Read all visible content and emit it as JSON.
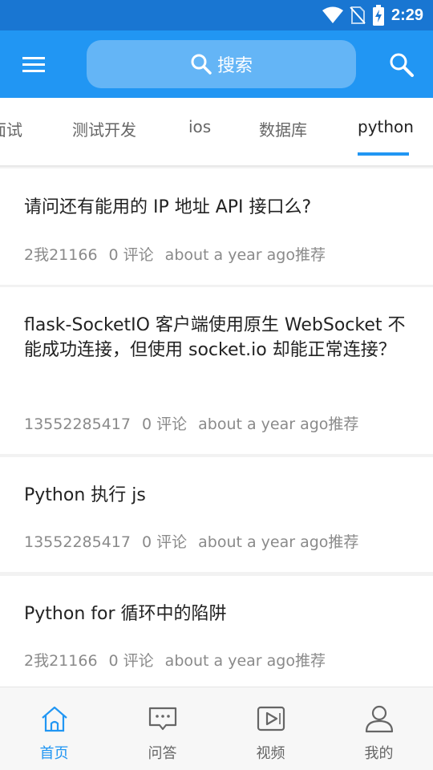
{
  "status_bar": {
    "time": "2:29"
  },
  "app_bar": {
    "search_label": "搜索"
  },
  "tabs": [
    {
      "label": "面试"
    },
    {
      "label": "测试开发"
    },
    {
      "label": "ios"
    },
    {
      "label": "数据库"
    },
    {
      "label": "python",
      "active": true
    }
  ],
  "posts": [
    {
      "title": "请问还有能用的 IP 地址 API 接口么?",
      "author": "2我21166",
      "comments": "0 评论",
      "time": "about a year ago推荐"
    },
    {
      "title": "flask-SocketIO 客户端使用原生 WebSocket 不能成功连接，但使用 socket.io 却能正常连接？",
      "author": "13552285417",
      "comments": "0 评论",
      "time": "about a year ago推荐"
    },
    {
      "title": "Python 执行 js",
      "author": "13552285417",
      "comments": "0 评论",
      "time": "about a year ago推荐"
    },
    {
      "title": "Python for 循环中的陷阱",
      "author": "2我21166",
      "comments": "0 评论",
      "time": "about a year ago推荐"
    }
  ],
  "bottom_nav": [
    {
      "label": "首页",
      "icon": "home-icon",
      "active": true
    },
    {
      "label": "问答",
      "icon": "chat-icon"
    },
    {
      "label": "视频",
      "icon": "video-icon"
    },
    {
      "label": "我的",
      "icon": "user-icon"
    }
  ],
  "colors": {
    "primary": "#2196f3",
    "status_bar": "#1976d2",
    "search_pill": "#64b5f6"
  }
}
